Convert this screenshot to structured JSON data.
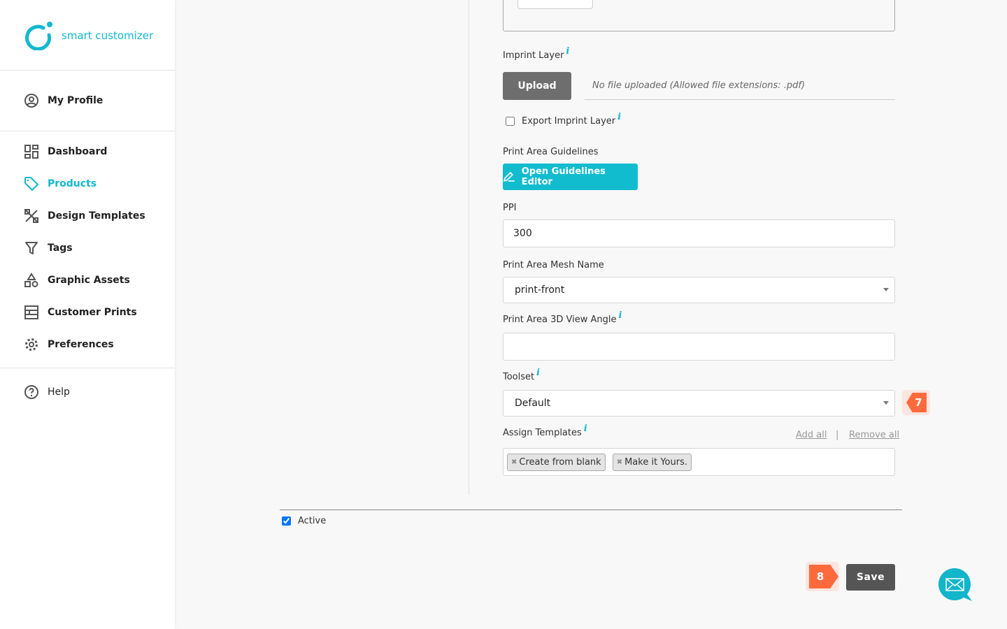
{
  "brand": {
    "name": "smart customizer",
    "color": "#12b8cf"
  },
  "sidebar": {
    "profile": {
      "label": "My Profile",
      "icon": "user-circle-icon"
    },
    "items": [
      {
        "label": "Dashboard",
        "icon": "dashboard-icon"
      },
      {
        "label": "Products",
        "icon": "tag-icon",
        "active": true
      },
      {
        "label": "Design Templates",
        "icon": "tools-icon"
      },
      {
        "label": "Tags",
        "icon": "filter-icon"
      },
      {
        "label": "Graphic Assets",
        "icon": "shapes-icon"
      },
      {
        "label": "Customer Prints",
        "icon": "prints-icon"
      },
      {
        "label": "Preferences",
        "icon": "gear-icon"
      }
    ],
    "help": {
      "label": "Help",
      "icon": "help-circle-icon"
    }
  },
  "form": {
    "imprint_layer": {
      "label": "Imprint Layer",
      "upload_label": "Upload",
      "status": "No file uploaded (Allowed file extensions: .pdf)"
    },
    "export_imprint": {
      "label": "Export Imprint Layer",
      "checked": false
    },
    "guidelines": {
      "label": "Print Area Guidelines",
      "button": "Open Guidelines Editor"
    },
    "ppi": {
      "label": "PPI",
      "value": "300"
    },
    "mesh_name": {
      "label": "Print Area Mesh Name",
      "value": "print-front"
    },
    "view_angle": {
      "label": "Print Area 3D View Angle",
      "value": ""
    },
    "toolset": {
      "label": "Toolset",
      "value": "Default"
    },
    "templates": {
      "label": "Assign Templates",
      "add_all": "Add all",
      "separator": "|",
      "remove_all": "Remove all",
      "tags": [
        "Create from blank",
        "Make it Yours."
      ]
    },
    "active": {
      "label": "Active",
      "checked": true
    },
    "save": "Save"
  },
  "badges": {
    "toolset": "7",
    "save": "8",
    "color": "#ff6a3d"
  },
  "chat": {
    "icon": "mail-icon"
  }
}
